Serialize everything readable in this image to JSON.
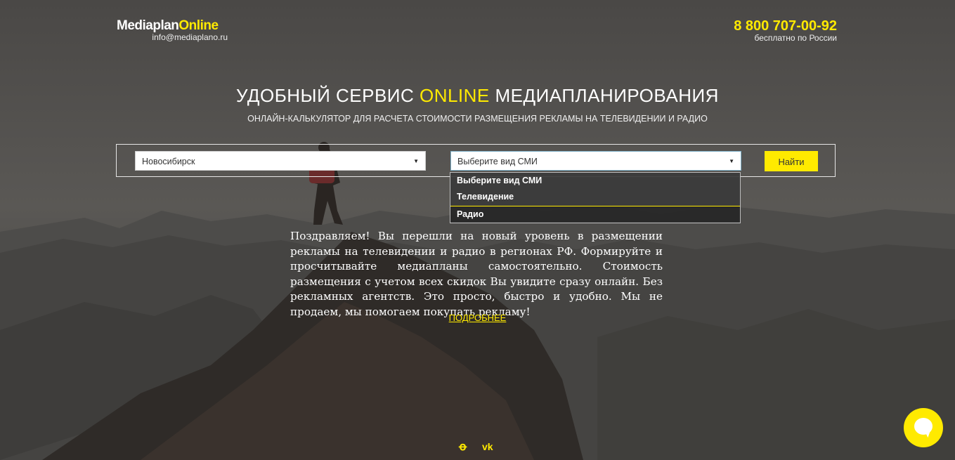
{
  "header": {
    "logo_part1": "Mediaplan",
    "logo_part2": "Online",
    "email": "info@mediaplano.ru",
    "phone": "8 800 707-00-92",
    "phone_note": "бесплатно по России"
  },
  "hero": {
    "title_part1": "УДОБНЫЙ СЕРВИС ",
    "title_accent": "ONLINE",
    "title_part2": " МЕДИАПЛАНИРОВАНИЯ",
    "subtitle": "ОНЛАЙН-КАЛЬКУЛЯТОР ДЛЯ РАСЧЕТА СТОИМОСТИ РАЗМЕЩЕНИЯ РЕКЛАМЫ НА ТЕЛЕВИДЕНИИ И РАДИО"
  },
  "search": {
    "city_value": "Новосибирск",
    "media_value": "Выберите вид СМИ",
    "button_label": "Найти",
    "media_options": [
      "Выберите вид СМИ",
      "Телевидение",
      "Радио"
    ]
  },
  "content": {
    "description": "Поздравляем! Вы перешли на новый уровень в размещении рекламы на телевидении и радио в регионах РФ. Формируйте и просчитывайте медиапланы самостоятельно. Стоимость размещения с учетом всех скидок Вы увидите сразу онлайн. Без рекламных агентств. Это просто, быстро и удобно. Мы не продаем, мы помогаем покупать рекламу!",
    "more_link": "ПОДРОБНЕЕ"
  },
  "social": {
    "ok_icon": "odnoklassniki-icon",
    "vk_icon": "vk-icon",
    "ok_glyph": "ꝋ",
    "vk_glyph": "vk"
  },
  "chat": {
    "icon": "chat-icon"
  },
  "colors": {
    "accent": "#ffea00",
    "overlay": "#3c3a37"
  }
}
